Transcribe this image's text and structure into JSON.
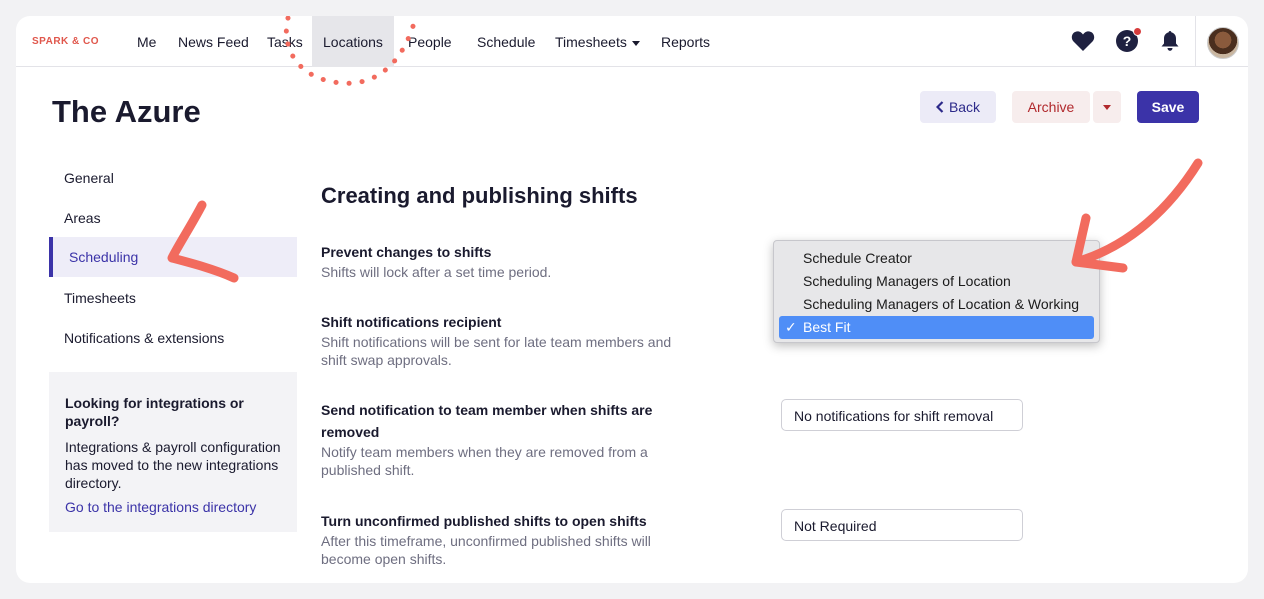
{
  "brand": "SPARK & CO",
  "topnav": {
    "items": [
      {
        "label": "Me"
      },
      {
        "label": "News Feed"
      },
      {
        "label": "Tasks"
      },
      {
        "label": "Locations"
      },
      {
        "label": "People"
      },
      {
        "label": "Schedule"
      },
      {
        "label": "Timesheets"
      },
      {
        "label": "Reports"
      }
    ],
    "active": "Locations",
    "icons": [
      "heart-icon",
      "help-icon",
      "bell-icon",
      "avatar"
    ]
  },
  "page": {
    "title": "The Azure",
    "buttons": {
      "back": "Back",
      "archive": "Archive",
      "save": "Save"
    }
  },
  "sidebar": {
    "items": [
      {
        "label": "General"
      },
      {
        "label": "Areas"
      },
      {
        "label": "Scheduling"
      },
      {
        "label": "Timesheets"
      },
      {
        "label": "Notifications & extensions"
      }
    ],
    "active": "Scheduling",
    "info": {
      "title": "Looking for integrations or payroll?",
      "body": "Integrations & payroll configuration has moved to the new integrations directory.",
      "link": "Go to the integrations directory"
    }
  },
  "main": {
    "section_title": "Creating and publishing shifts",
    "settings": [
      {
        "title": "Prevent changes to shifts",
        "desc": "Shifts will lock after a set time period.",
        "value": ""
      },
      {
        "title": "Shift notifications recipient",
        "desc": "Shift notifications will be sent for late team members and shift swap approvals.",
        "value": "Best Fit"
      },
      {
        "title": "Send notification to team member when shifts are removed",
        "desc": "Notify team members when they are removed from a published shift.",
        "value": "No notifications for shift removal"
      },
      {
        "title": "Turn unconfirmed published shifts to open shifts",
        "desc": "After this timeframe, unconfirmed published shifts will become open shifts.",
        "value": "Not Required"
      }
    ],
    "dropdown": {
      "options": [
        "Schedule Creator",
        "Scheduling Managers of Location",
        "Scheduling Managers of Location & Working",
        "Best Fit"
      ],
      "selected": "Best Fit",
      "check": "✓"
    }
  },
  "colors": {
    "brand": "#e0574c",
    "accent": "#3b33a8",
    "archive": "#b1292d",
    "annotation": "#f26b5e",
    "dropdown_selected": "#4f8ef7"
  }
}
